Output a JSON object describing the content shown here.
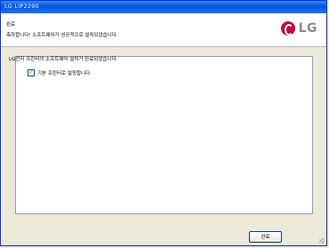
{
  "window": {
    "title": "LG LIP2290"
  },
  "header": {
    "title": "완료",
    "subtitle": "축하합니다! 소프트웨어가 성공적으로 설치되었습니다.",
    "logo_text": "LG"
  },
  "main": {
    "message": "LG전자 프린터의 소프트웨어 설치가 완료되었습니다.",
    "checkbox": {
      "label": "기본 프린터로 설정합니다.",
      "checked": true
    }
  },
  "buttons": {
    "finish_label": "완료"
  },
  "colors": {
    "lg_red": "#c4003a",
    "titlebar_blue": "#0054e3"
  }
}
